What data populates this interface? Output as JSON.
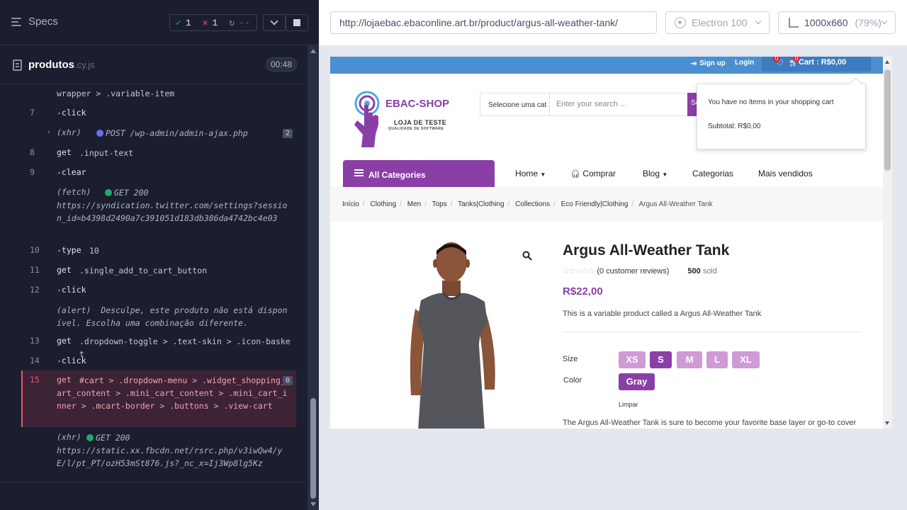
{
  "reporter": {
    "specs_label": "Specs",
    "stats": {
      "passed": "1",
      "failed": "1",
      "pending": "--"
    },
    "file": {
      "name": "produtos",
      "ext": ".cy.js",
      "duration": "00:48"
    },
    "commands": [
      {
        "num": "",
        "name": "",
        "msg": "wrapper > .variable-item"
      },
      {
        "num": "7",
        "name": "-click",
        "msg": ""
      },
      {
        "num": "",
        "name": "(xhr)",
        "msg": "POST /wp-admin/admin-ajax.php",
        "count": "2"
      },
      {
        "num": "8",
        "name": "get",
        "msg": ".input-text"
      },
      {
        "num": "9",
        "name": "-clear",
        "msg": ""
      },
      {
        "num": "",
        "name": "(fetch)",
        "msg": "GET 200",
        "url": "https://syndication.twitter.com/settings?session_id=b4398d2490a7c391051d183db386da4742bc4e03"
      },
      {
        "num": "10",
        "name": "-type",
        "msg": "10"
      },
      {
        "num": "11",
        "name": "get",
        "msg": ".single_add_to_cart_button"
      },
      {
        "num": "12",
        "name": "-click",
        "msg": ""
      },
      {
        "num": "",
        "name": "(alert)",
        "msg": "Desculpe, este produto não está disponível. Escolha uma combinação diferente."
      },
      {
        "num": "13",
        "name": "get",
        "msg": ".dropdown-toggle > .text-skin > .icon-basket"
      },
      {
        "num": "14",
        "name": "-click",
        "msg": ""
      },
      {
        "num": "15",
        "name": "get",
        "msg": "#cart > .dropdown-menu > .widget_shopping_cart_content > .mini_cart_content > .mini_cart_inner > .mcart-border > .buttons > .view-cart",
        "count": "0"
      },
      {
        "num": "",
        "name": "(xhr)",
        "msg": "GET 200",
        "url": "https://static.xx.fbcdn.net/rsrc.php/v3iwQw4/yE/l/pt_PT/ozH53mSt876.js?_nc_x=Ij3Wp8lg5Kz"
      }
    ]
  },
  "aut_header": {
    "url": "http://lojaebac.ebaconline.art.br/product/argus-all-weather-tank/",
    "browser": "Electron 100",
    "viewport": "1000x660",
    "zoom": "(79%)"
  },
  "site": {
    "topbar": {
      "signup": "Sign up",
      "login": "Login",
      "wish_count": "0",
      "cart_count": "0",
      "cart_label": "Cart : R$0,00"
    },
    "logo": {
      "brand": "EBAC-SHOP",
      "tagline": "LOJA DE TESTE",
      "tagline2": "QUALIDADE DE SOFTWARE"
    },
    "search": {
      "category": "Selecione uma cat",
      "placeholder": "Enter your search ...",
      "button": "Se"
    },
    "cart_dropdown": {
      "empty": "You have no items in your shopping cart",
      "subtotal": "Subtotal: R$0,00"
    },
    "nav": {
      "all_categories": "All Categories",
      "items": [
        "Home",
        "Comprar",
        "Blog",
        "Categorias",
        "Mais vendidos"
      ]
    },
    "breadcrumbs": [
      "Início",
      "Clothing",
      "Men",
      "Tops",
      "Tanks|Clothing",
      "Collections",
      "Eco Friendly|Clothing",
      "Argus All-Weather Tank"
    ],
    "product": {
      "title": "Argus All-Weather Tank",
      "reviews": "(0 customer reviews)",
      "sold_count": "500",
      "sold_label": "sold",
      "price": "R$22,00",
      "short_desc": "This is a variable product called a Argus All-Weather Tank",
      "size_label": "Size",
      "sizes": [
        "XS",
        "S",
        "M",
        "L",
        "XL"
      ],
      "selected_size": "S",
      "color_label": "Color",
      "color": "Gray",
      "clear": "Limpar",
      "long_desc": "The Argus All-Weather Tank is sure to become your favorite base layer or go-to cover"
    }
  },
  "colors": {
    "accent": "#8a3fa6",
    "topbar": "#4a8fcf",
    "fail": "#e45770",
    "pass": "#1fa971"
  }
}
